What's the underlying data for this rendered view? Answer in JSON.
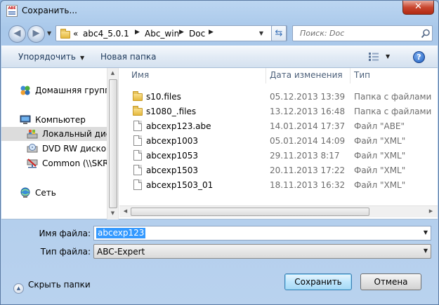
{
  "window": {
    "title": "Сохранить...",
    "app_icon_text": "ABE",
    "close_glyph": "✕"
  },
  "address_bar": {
    "overflow_glyph": "«",
    "crumbs": [
      "abc4_5.0.1",
      "Abc_win",
      "Doc"
    ]
  },
  "search": {
    "placeholder": "Поиск: Doc"
  },
  "toolbar": {
    "organize_label": "Упорядочить",
    "new_folder_label": "Новая папка",
    "help_glyph": "?"
  },
  "nav_pane": {
    "items": [
      {
        "label": "Домашняя группа",
        "icon": "homegroup-icon"
      },
      {
        "label": "Компьютер",
        "icon": "computer-icon"
      },
      {
        "label": "Локальный диск",
        "icon": "local-disk-icon"
      },
      {
        "label": "DVD RW дисковод",
        "icon": "dvd-drive-icon"
      },
      {
        "label": "Common (\\\\SKR",
        "icon": "network-drive-icon"
      },
      {
        "label": "Сеть",
        "icon": "network-icon"
      }
    ]
  },
  "file_list": {
    "columns": {
      "name": "Имя",
      "date": "Дата изменения",
      "type": "Тип"
    },
    "rows": [
      {
        "name": "s10.files",
        "date": "05.12.2013 13:39",
        "type": "Папка с файлами",
        "kind": "folder"
      },
      {
        "name": "s1080_.files",
        "date": "13.12.2013 16:48",
        "type": "Папка с файлами",
        "kind": "folder"
      },
      {
        "name": "abcexp123.abe",
        "date": "14.01.2014 17:37",
        "type": "Файл \"ABE\"",
        "kind": "file"
      },
      {
        "name": "abcexp1003",
        "date": "05.01.2014 14:09",
        "type": "Файл \"XML\"",
        "kind": "file"
      },
      {
        "name": "abcexp1053",
        "date": "29.11.2013 8:17",
        "type": "Файл \"XML\"",
        "kind": "file"
      },
      {
        "name": "abcexp1503",
        "date": "20.11.2013 17:22",
        "type": "Файл \"XML\"",
        "kind": "file"
      },
      {
        "name": "abcexp1503_01",
        "date": "18.11.2013 16:32",
        "type": "Файл \"XML\"",
        "kind": "file"
      }
    ]
  },
  "form": {
    "filename_label": "Имя файла:",
    "filename_value": "abcexp123",
    "filetype_label": "Тип файла:",
    "filetype_value": "ABC-Expert"
  },
  "footer": {
    "hide_folders_label": "Скрыть папки",
    "save_label": "Сохранить",
    "cancel_label": "Отмена"
  }
}
